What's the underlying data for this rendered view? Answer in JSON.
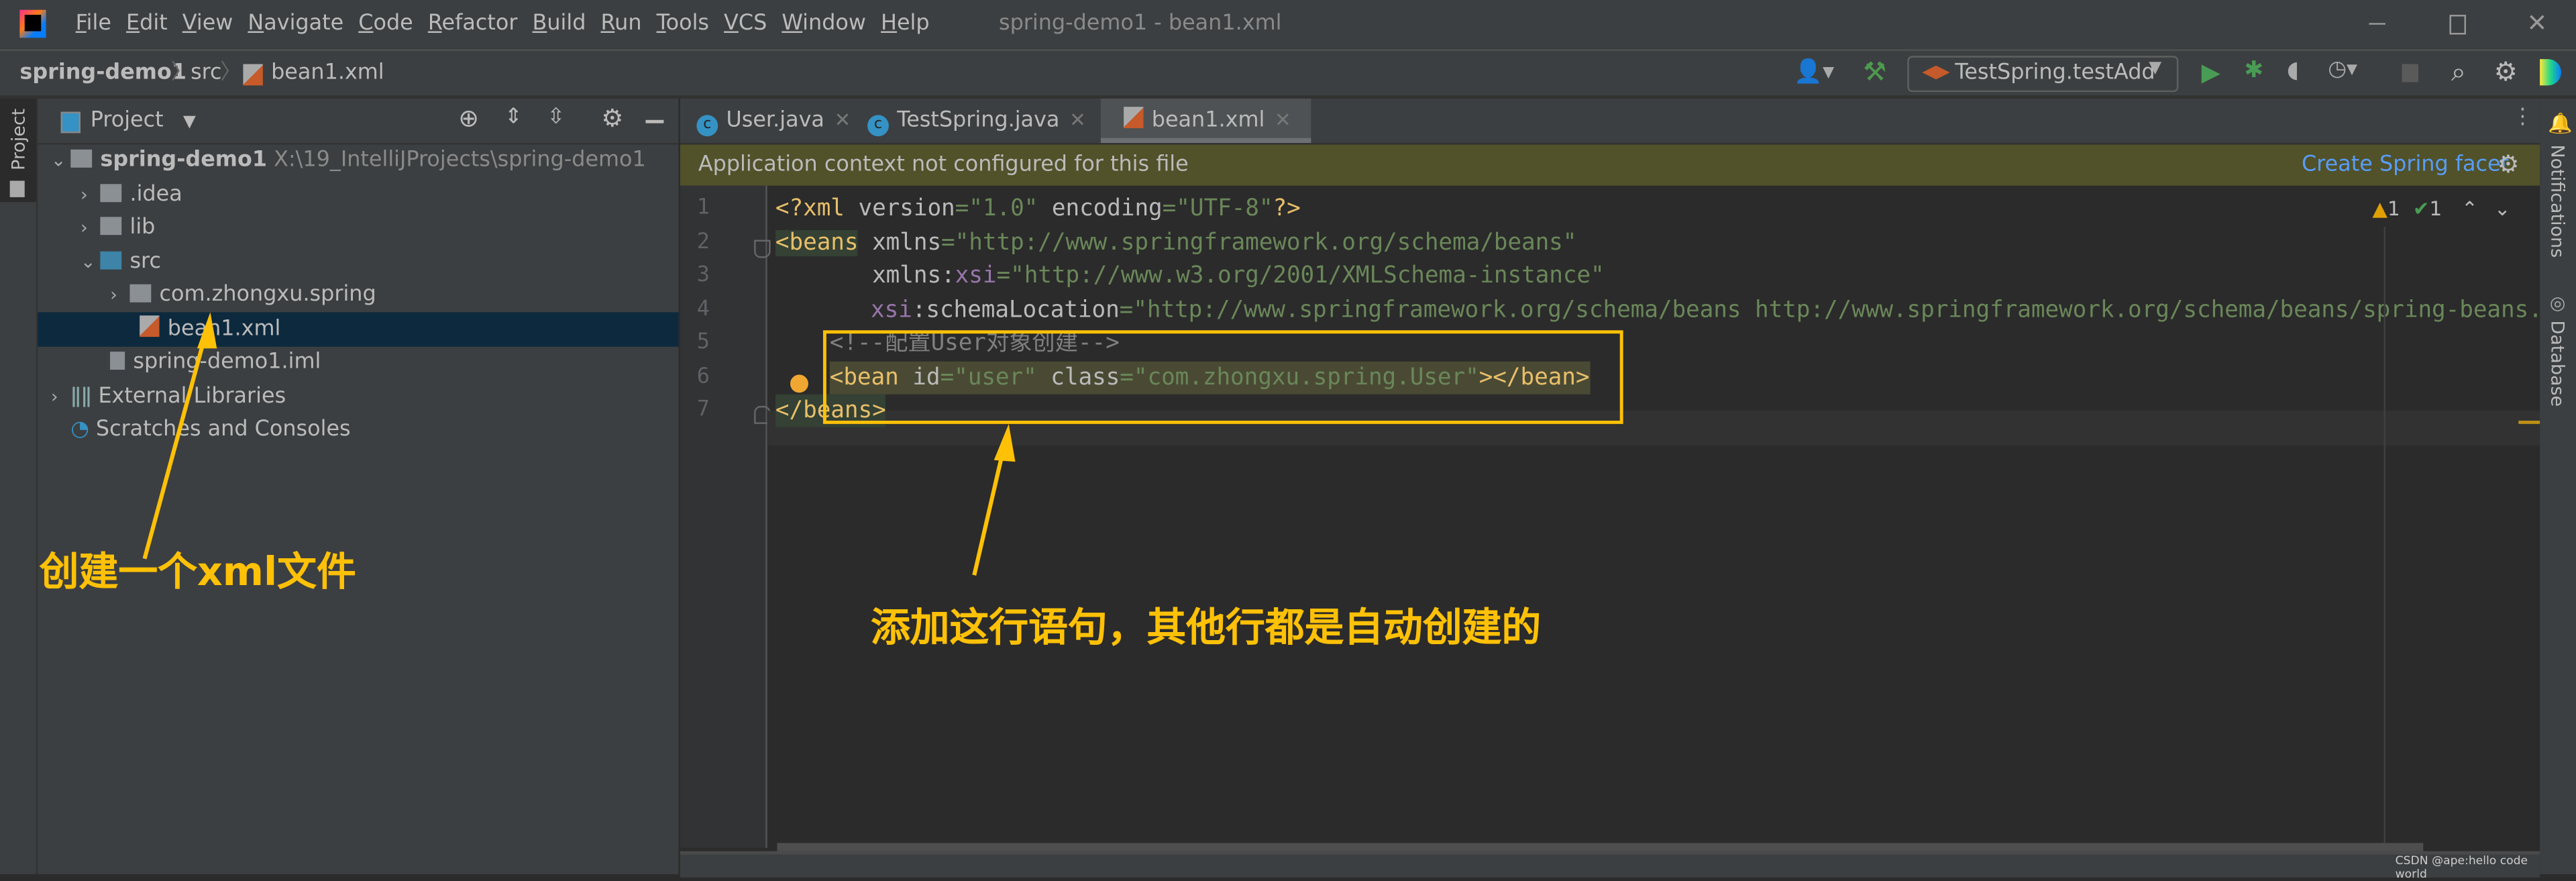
{
  "window": {
    "title": "spring-demo1 - bean1.xml"
  },
  "menu": [
    "File",
    "Edit",
    "View",
    "Navigate",
    "Code",
    "Refactor",
    "Build",
    "Run",
    "Tools",
    "VCS",
    "Window",
    "Help"
  ],
  "breadcrumb": [
    "spring-demo1",
    "src",
    "bean1.xml"
  ],
  "toolbar": {
    "run_config": "TestSpring.testAdd"
  },
  "project_panel": {
    "title": "Project",
    "strip_label": "Project",
    "tree": [
      {
        "label": "spring-demo1",
        "path": "X:\\19_IntelliJProjects\\spring-demo1"
      },
      {
        "label": ".idea"
      },
      {
        "label": "lib"
      },
      {
        "label": "src"
      },
      {
        "label": "com.zhongxu.spring"
      },
      {
        "label": "bean1.xml"
      },
      {
        "label": "spring-demo1.iml"
      },
      {
        "label": "External Libraries"
      },
      {
        "label": "Scratches and Consoles"
      }
    ]
  },
  "tabs": [
    {
      "label": "User.java"
    },
    {
      "label": "TestSpring.java"
    },
    {
      "label": "bean1.xml",
      "active": true
    }
  ],
  "banner": {
    "message": "Application context not configured for this file",
    "action": "Create Spring facet"
  },
  "inspections": {
    "warnings": "1",
    "typos": "1"
  },
  "code": {
    "l1": {
      "a": "<?xml ",
      "b": "version",
      "c": "=",
      "d": "\"1.0\"",
      "e": " ",
      "f": "encoding",
      "g": "=",
      "h": "\"UTF-8\"",
      "i": "?>"
    },
    "l2": {
      "a": "<beans",
      "b": " xmlns",
      "c": "=",
      "d": "\"http://www.springframework.org/schema/beans\""
    },
    "l3": {
      "a": "       xmlns:",
      "b": "xsi",
      "c": "=",
      "d": "\"http://www.w3.org/2001/XMLSchema-instance\""
    },
    "l4": {
      "a": "xsi",
      "b": ":schemaLocation",
      "c": "=",
      "d": "\"http://www.springframework.org/schema/beans http://www.springframework.org/schema/beans/spring-beans.xsd\""
    },
    "l5": "<!--配置User对象创建-->",
    "l6": {
      "a": "<bean",
      "b": " id",
      "c": "=",
      "d": "\"user\"",
      "e": " class",
      "f": "=",
      "g": "\"com.zhongxu.spring.User\"",
      "h": "></bean>"
    },
    "l7": "</beans>",
    "line_numbers": [
      "1",
      "2",
      "3",
      "4",
      "5",
      "6",
      "7"
    ]
  },
  "right_strip": {
    "notifications": "Notifications",
    "database": "Database"
  },
  "annotations": {
    "left": "创建一个xml文件",
    "right": "添加这行语句，其他行都是自动创建的",
    "color": "#ffc107"
  },
  "watermark": "CSDN @ape:hello code world"
}
